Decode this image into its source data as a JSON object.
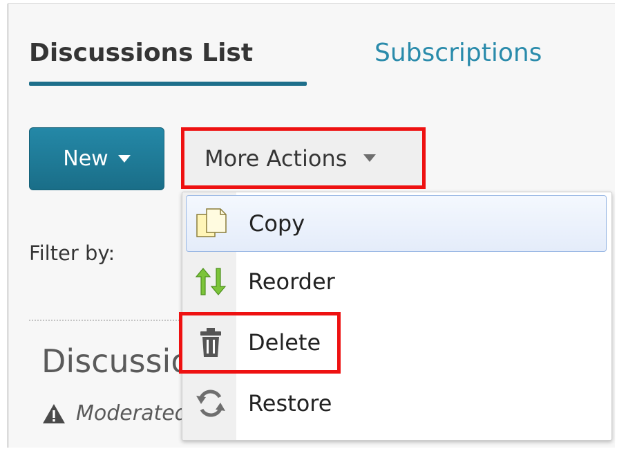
{
  "tabs": {
    "active": "Discussions List",
    "other": "Subscriptions"
  },
  "toolbar": {
    "new_label": "New",
    "more_actions_label": "More Actions"
  },
  "filter": {
    "label": "Filter by:"
  },
  "section": {
    "heading": "Discussions",
    "warning_text": "Moderated"
  },
  "menu": {
    "items": [
      {
        "label": "Copy",
        "icon": "copy-icon",
        "selected": true
      },
      {
        "label": "Reorder",
        "icon": "reorder-icon"
      },
      {
        "label": "Delete",
        "icon": "trash-icon"
      },
      {
        "label": "Restore",
        "icon": "restore-icon"
      }
    ]
  },
  "colors": {
    "accent": "#1e6f8b",
    "link": "#2a8bab",
    "annotation_red": "#ee1111"
  }
}
